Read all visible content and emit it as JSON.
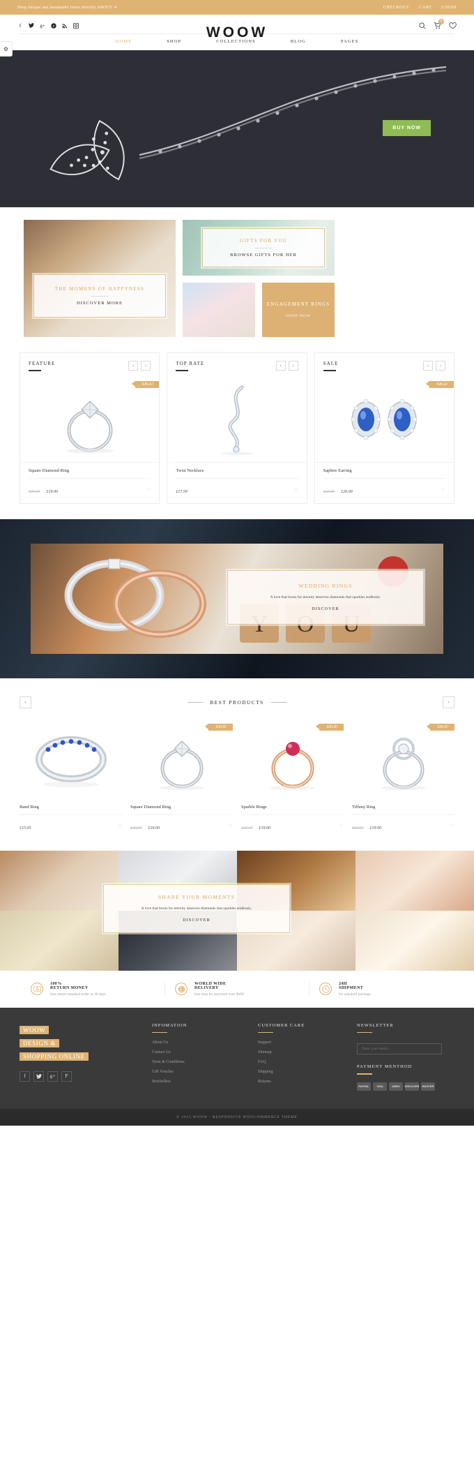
{
  "topbar": {
    "promo_text": "Shop unique and handmade items directly ABOUT ⇒",
    "links": [
      "CHECKOUT",
      "CART",
      "LOGIN"
    ]
  },
  "header": {
    "brand": "WOOW",
    "stars": "☆ ☆ ☆ ☆ ☆",
    "social": [
      "facebook-icon",
      "twitter-icon",
      "google-plus-icon",
      "pinterest-icon",
      "rss-icon",
      "instagram-icon"
    ],
    "cart_count": "0",
    "icons": [
      "search-icon",
      "cart-icon",
      "wishlist-icon"
    ],
    "settings_tab_icon": "gear-icon"
  },
  "nav": {
    "items": [
      {
        "label": "HOME",
        "active": true
      },
      {
        "label": "SHOP",
        "active": false
      },
      {
        "label": "COLLECTIONS",
        "active": false
      },
      {
        "label": "BLOG",
        "active": false
      },
      {
        "label": "PAGES",
        "active": false
      }
    ]
  },
  "hero": {
    "cta_label": "BUY NOW",
    "cta_color": "#8fbc54",
    "background_color": "#2e2f36"
  },
  "promo": {
    "bride": {
      "title": "THE MOMENS OF HAPPYNESS",
      "link": "DISCOVER MORE"
    },
    "gift": {
      "title": "GIFTS FOR YOU",
      "link": "BROWSE GIFTS FOR HER"
    },
    "engagement": {
      "title": "ENGAGEMENT RINGS",
      "link": "SHOP NOW",
      "bg": "#ddb173"
    }
  },
  "carousels": [
    {
      "title": "FEATURE",
      "prev": "‹",
      "next": "›",
      "sale_tag": "SALE!",
      "has_sale": true,
      "product": {
        "name": "Square Diamond Ring",
        "price_old": "£20.50",
        "price_new": "£19.00"
      }
    },
    {
      "title": "TOP RATE",
      "prev": "‹",
      "next": "›",
      "sale_tag": "",
      "has_sale": false,
      "product": {
        "name": "Twist Necklace",
        "price_old": "",
        "price_new": "£17.50"
      }
    },
    {
      "title": "SALE",
      "prev": "‹",
      "next": "›",
      "sale_tag": "SALE!",
      "has_sale": true,
      "product": {
        "name": "Saphire Earring",
        "price_old": "£23.00",
        "price_new": "£20.00"
      }
    }
  ],
  "wide_banner": {
    "title": "WEDDING RINGS",
    "subtitle": "A love that burns for eternity deserves diamonds that sparkles endlessly.",
    "button": "DISCOVER"
  },
  "best_products": {
    "title": "BEST PRODUCTS",
    "prev": "‹",
    "next": "›",
    "sale_tag": "SALE!",
    "items": [
      {
        "name": "Band Ring",
        "price_old": "",
        "price_new": "£15.05",
        "has_sale": false
      },
      {
        "name": "Square Diamond Ring",
        "price_old": "£20.50",
        "price_new": "£19.00",
        "has_sale": true
      },
      {
        "name": "Sparkle Rings",
        "price_old": "£20.50",
        "price_new": "£19.00",
        "has_sale": true
      },
      {
        "name": "Tiffany Ring",
        "price_old": "£20.50",
        "price_new": "£19.00",
        "has_sale": true
      }
    ]
  },
  "mosaic": {
    "title": "SHARE YOUR MOMENTS",
    "subtitle": "A love that burns for eternity deserves diamonds that sparkles endlessly.",
    "button": "DISCOVER"
  },
  "services": [
    {
      "icon": "money-icon",
      "line1": "100%",
      "line2": "RETURN MONEY",
      "desc": "free return standard order in 30 days"
    },
    {
      "icon": "globe-icon",
      "line1": "WORLD WIDE",
      "line2": "DELIVERY",
      "desc": "free ship for payment over $100"
    },
    {
      "icon": "clock-icon",
      "line1": "24H",
      "line2": "SHIPMENT",
      "desc": "for standard package"
    }
  ],
  "footer": {
    "brand_lines": [
      "WOOW",
      "DESIGN &",
      "SHOPPING ONLINE"
    ],
    "social": [
      "facebook-icon",
      "twitter-icon",
      "google-plus-icon",
      "pinterest-icon"
    ],
    "columns": [
      {
        "title": "INFOMATION",
        "links": [
          "About Us",
          "Contact Us",
          "Term & Conditions",
          "Gift Voucher",
          "BestSellers"
        ]
      },
      {
        "title": "CUSTOMER CARE",
        "links": [
          "Support",
          "Sitemap",
          "FAQ",
          "Shipping",
          "Returns"
        ]
      }
    ],
    "newsletter": {
      "title": "NEWSLETTER",
      "placeholder": "Enter your email..."
    },
    "payment": {
      "title": "PAYMENT MENTHOD",
      "methods": [
        "PAYPAL",
        "VISA",
        "AMEX",
        "DISCOVER",
        "MASTER"
      ]
    },
    "copyright": "© 2015 WOOW - RESPONSIVE WOOCOMMERCE THEME",
    "accent": "#dfb372"
  }
}
